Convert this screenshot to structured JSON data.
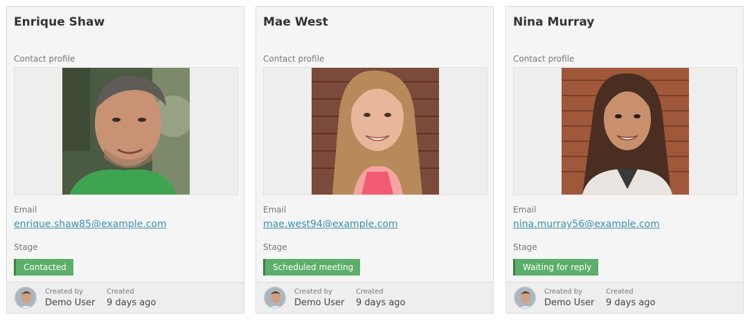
{
  "contacts": [
    {
      "name": "Enrique Shaw",
      "profile_label": "Contact profile",
      "email_label": "Email",
      "email": "enrique.shaw85@example.com",
      "stage_label": "Stage",
      "stage": "Contacted",
      "created_by_label": "Created by",
      "created_by": "Demo User",
      "created_label": "Created",
      "created": "9 days ago"
    },
    {
      "name": "Mae West",
      "profile_label": "Contact profile",
      "email_label": "Email",
      "email": "mae.west94@example.com",
      "stage_label": "Stage",
      "stage": "Scheduled meeting",
      "created_by_label": "Created by",
      "created_by": "Demo User",
      "created_label": "Created",
      "created": "9 days ago"
    },
    {
      "name": "Nina Murray",
      "profile_label": "Contact profile",
      "email_label": "Email",
      "email": "nina.murray56@example.com",
      "stage_label": "Stage",
      "stage": "Waiting for reply",
      "created_by_label": "Created by",
      "created_by": "Demo User",
      "created_label": "Created",
      "created": "9 days ago"
    }
  ],
  "colors": {
    "stage_badge": "#5cae6a",
    "link": "#3a8fb5"
  }
}
